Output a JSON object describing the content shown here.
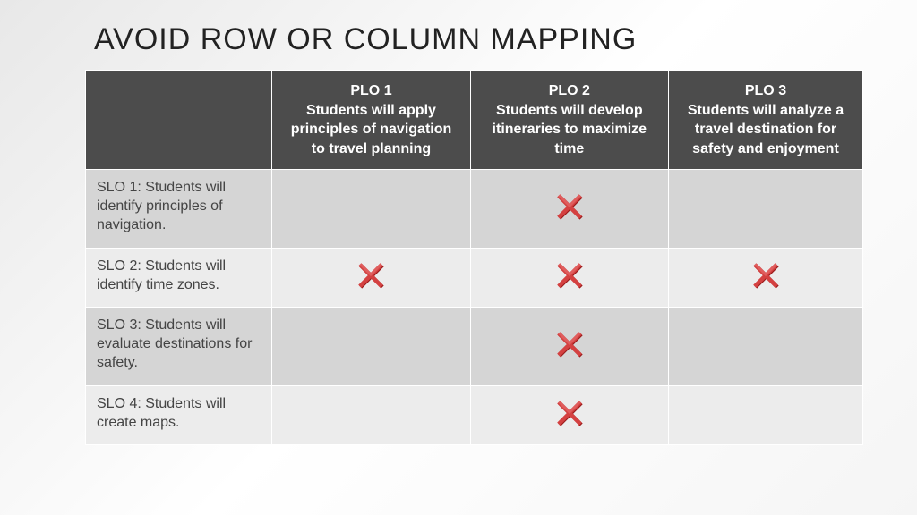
{
  "title": "AVOID ROW OR COLUMN MAPPING",
  "columns": [
    {
      "num": "PLO 1",
      "desc": "Students will apply principles of navigation to travel planning"
    },
    {
      "num": "PLO 2",
      "desc": "Students will develop itineraries to maximize time"
    },
    {
      "num": "PLO 3",
      "desc": "Students will analyze a travel destination for safety and enjoyment"
    }
  ],
  "rows": [
    {
      "label": "SLO 1: Students will identify principles of navigation.",
      "marks": [
        false,
        true,
        false
      ]
    },
    {
      "label": "SLO 2: Students will identify time zones.",
      "marks": [
        true,
        true,
        true
      ]
    },
    {
      "label": "SLO 3: Students will evaluate destinations for safety.",
      "marks": [
        false,
        true,
        false
      ]
    },
    {
      "label": "SLO 4: Students will create maps.",
      "marks": [
        false,
        true,
        false
      ]
    }
  ],
  "icon_name": "x-mark-icon"
}
